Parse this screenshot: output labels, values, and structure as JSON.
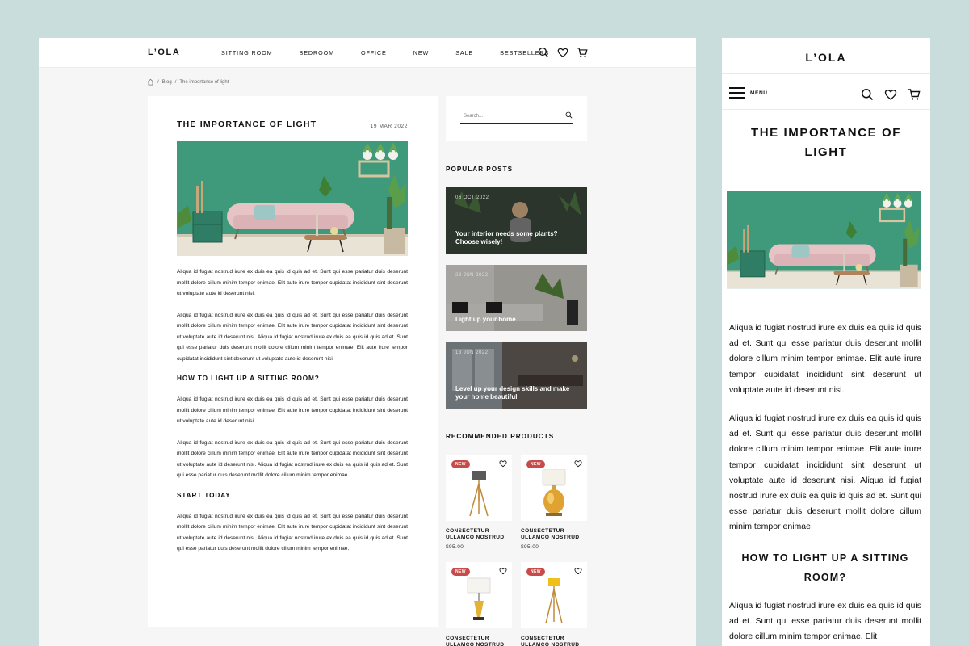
{
  "brand": "L’OLA",
  "nav": [
    "SITTING ROOM",
    "BEDROOM",
    "OFFICE",
    "NEW",
    "SALE",
    "BESTSELLERS"
  ],
  "breadcrumb": [
    "Blog",
    "The importance of light"
  ],
  "article": {
    "title": "THE IMPORTANCE OF LIGHT",
    "date": "19 MAR 2022",
    "p1": "Aliqua id fugiat nostrud irure ex duis ea quis id quis ad et. Sunt qui esse pariatur duis deserunt mollit dolore cillum minim tempor enimae. Elit aute irure tempor cupidatat incididunt sint deserunt ut voluptate aute id deserunt nisi.",
    "p2": "Aliqua id fugiat nostrud irure ex duis ea quis id quis ad et. Sunt qui esse pariatur duis deserunt mollit dolore cillum minim tempor enimae. Elit aute irure tempor cupidatat incididunt sint deserunt ut voluptate aute id deserunt nisi. Aliqua id fugiat nostrud irure ex duis ea quis id quis ad et. Sunt qui esse pariatur duis deserunt mollit dolore cillum minim tempor enimae. Elit aute irure tempor cupidatat incididunt sint deserunt ut voluptate aute id deserunt nisi.",
    "h2": "HOW TO LIGHT UP A SITTING ROOM?",
    "p3": "Aliqua id fugiat nostrud irure ex duis ea quis id quis ad et. Sunt qui esse pariatur duis deserunt mollit dolore cillum minim tempor enimae. Elit aute irure tempor cupidatat incididunt sint deserunt ut voluptate aute id deserunt nisi.",
    "p4": "Aliqua id fugiat nostrud irure ex duis ea quis id quis ad et. Sunt qui esse pariatur duis deserunt mollit dolore cillum minim tempor enimae. Elit aute irure tempor cupidatat incididunt sint deserunt ut voluptate aute id deserunt nisi. Aliqua id fugiat nostrud irure ex duis ea quis id quis ad et. Sunt qui esse pariatur duis deserunt mollit dolore cillum minim tempor enimae.",
    "h3": "START TODAY",
    "p5": "Aliqua id fugiat nostrud irure ex duis ea quis id quis ad et. Sunt qui esse pariatur duis deserunt mollit dolore cillum minim tempor enimae. Elit aute irure tempor cupidatat incididunt sint deserunt ut voluptate aute id deserunt nisi. Aliqua id fugiat nostrud irure ex duis ea quis id quis ad et. Sunt qui esse pariatur duis deserunt mollit dolore cillum minim tempor enimae."
  },
  "sidebar": {
    "search_placeholder": "Search...",
    "popular_title": "POPULAR POSTS",
    "posts": [
      {
        "date": "06 OCT 2022",
        "title": "Your interior needs some plants? Choose wisely!"
      },
      {
        "date": "23 JUN 2022",
        "title": "Light up your home"
      },
      {
        "date": "13 JUN 2022",
        "title": "Level up your design skills and make your home beautiful"
      }
    ],
    "recommended_title": "RECOMMENDED PRODUCTS",
    "badge": "NEW",
    "products": [
      {
        "name": "CONSECTETUR ULLAMCO NOSTRUD",
        "price": "$95.00"
      },
      {
        "name": "CONSECTETUR ULLAMCO NOSTRUD",
        "price": "$95.00"
      },
      {
        "name": "CONSECTETUR ULLAMCO NOSTRUD",
        "price": ""
      },
      {
        "name": "CONSECTETUR ULLAMCO NOSTRUD",
        "price": ""
      }
    ]
  },
  "mobile": {
    "brand": "L’OLA",
    "menu_label": "MENU",
    "title": "THE IMPORTANCE OF LIGHT",
    "p1": "Aliqua id fugiat nostrud irure ex duis ea quis id quis ad et. Sunt qui esse pariatur duis deserunt mollit dolore cillum minim tempor enimae. Elit aute irure tempor cupidatat incididunt sint deserunt ut voluptate aute id deserunt nisi.",
    "p2": "Aliqua id fugiat nostrud irure ex duis ea quis id quis ad et. Sunt qui esse pariatur duis deserunt mollit dolore cillum minim tempor enimae. Elit aute irure tempor cupidatat incididunt sint deserunt ut voluptate aute id deserunt nisi. Aliqua id fugiat nostrud irure ex duis ea quis id quis ad et. Sunt qui esse pariatur duis deserunt mollit dolore cillum minim tempor enimae.",
    "h2": "HOW TO LIGHT UP A SITTING ROOM?",
    "p3": "Aliqua id fugiat nostrud irure ex duis ea quis id quis ad et. Sunt qui esse pariatur duis deserunt mollit dolore cillum minim tempor enimae. Elit"
  },
  "colors": {
    "background": "#c9dedc",
    "wall_green": "#3f9a7c",
    "badge_red": "#c84b4b",
    "sofa_pink": "#e6c3c5"
  }
}
